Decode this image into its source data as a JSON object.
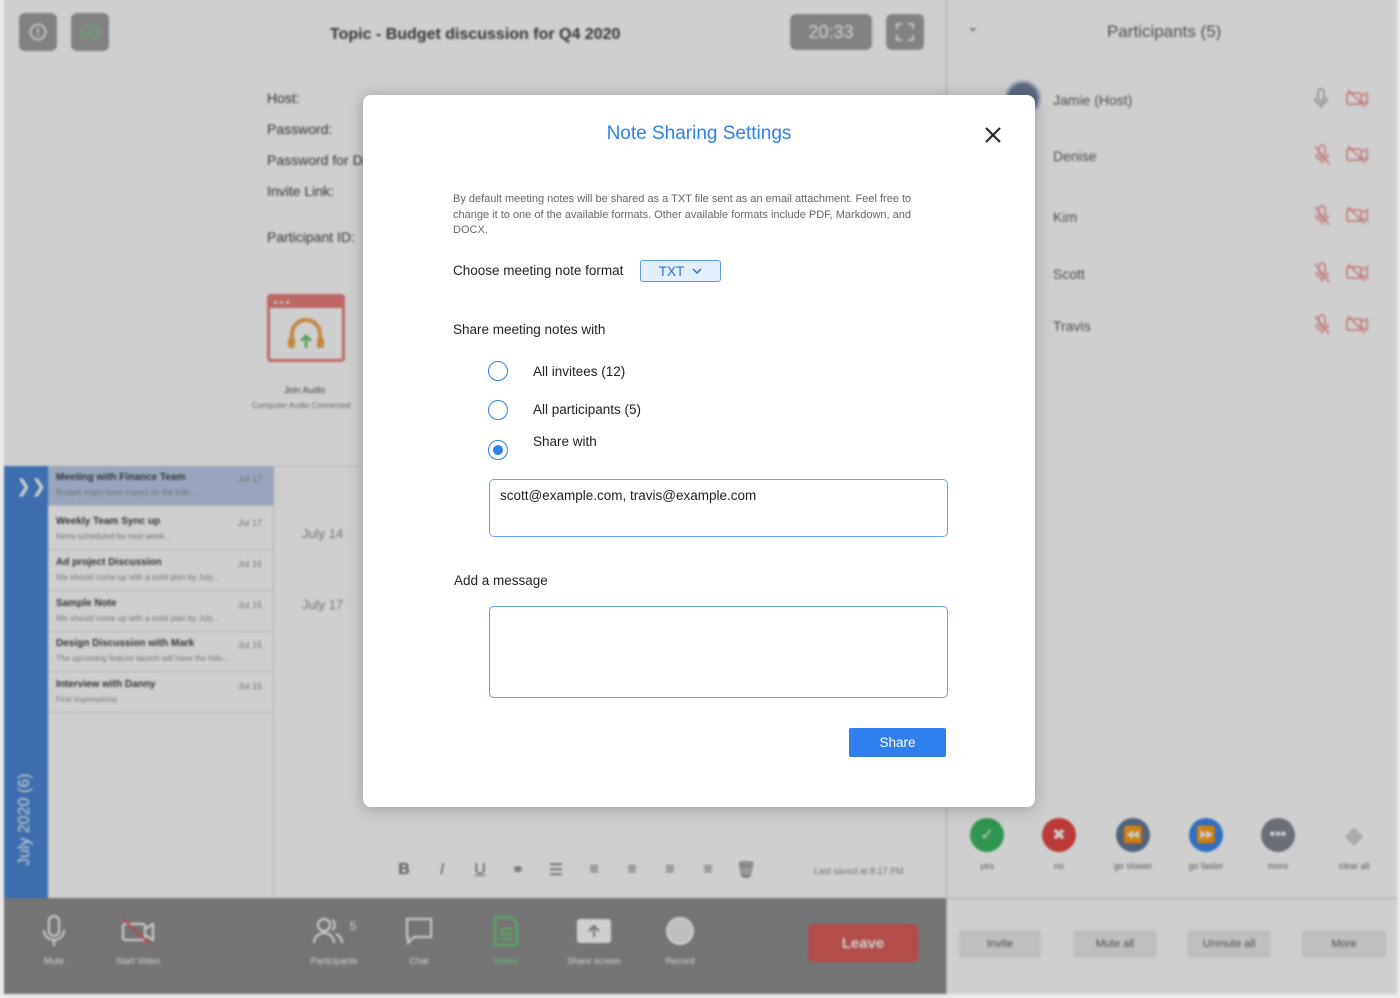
{
  "topbar": {
    "topic": "Topic - Budget discussion for Q4 2020",
    "timer": "20:33"
  },
  "meeting_info": {
    "host_label": "Host:",
    "password_label": "Password:",
    "password_di_label": "Password for Di",
    "invite_label": "Invite Link:",
    "participant_id_label": "Participant ID:"
  },
  "audio": {
    "join_label": "Join Audio",
    "status": "Computer Audio Connected"
  },
  "notes": {
    "month_label": "July 2020 (6)",
    "items": [
      {
        "title": "Meeting with Finance Team",
        "date": "Jul 17",
        "preview": "Budget might have impact on the follo..."
      },
      {
        "title": "Weekly Team Sync up",
        "date": "Jul 17",
        "preview": "Items scheduled for next week..."
      },
      {
        "title": "Ad project Discussion",
        "date": "Jul 16",
        "preview": "We should come up with a solid plan by July..."
      },
      {
        "title": "Sample Note",
        "date": "Jul 15",
        "preview": "We should come up with a solid plan by July..."
      },
      {
        "title": "Design Discussion with Mark",
        "date": "Jul 15",
        "preview": "The upcoming feature launch will have the follo..."
      },
      {
        "title": "Interview with Danny",
        "date": "Jul 15",
        "preview": "First impressions:"
      }
    ],
    "date_heads": [
      "July 14",
      "July 17"
    ],
    "last_saved": "Last saved at 8:17 PM"
  },
  "toolbar": {
    "mute": "Mute",
    "start_video": "Start Video",
    "participants": "Participants",
    "participants_count": "5",
    "chat": "Chat",
    "notes": "Notes",
    "share_screen": "Share screen",
    "record": "Record",
    "leave": "Leave"
  },
  "participants": {
    "title": "Participants (5)",
    "list": [
      {
        "name": "Jamie (Host)"
      },
      {
        "name": "Denise"
      },
      {
        "name": "Kim"
      },
      {
        "name": "Scott"
      },
      {
        "name": "Travis"
      }
    ],
    "reactions": [
      {
        "label": "yes",
        "color": "#2fb45a"
      },
      {
        "label": "no",
        "color": "#e53935"
      },
      {
        "label": "go slower",
        "color": "#5a6f8f"
      },
      {
        "label": "go faster",
        "color": "#2f80ed"
      },
      {
        "label": "more",
        "color": "#7a7f8a"
      },
      {
        "label": "clear all",
        "color": "#cfcfcf"
      }
    ],
    "buttons": {
      "invite": "Invite",
      "mute_all": "Mute all",
      "unmute_all": "Unmute all",
      "more": "More"
    }
  },
  "modal": {
    "title": "Note Sharing Settings",
    "description": "By default meeting notes will be shared as a TXT file sent as an email attachment. Feel free to change it to one of the available formats. Other available formats include PDF, Markdown, and DOCX.",
    "format_label": "Choose meeting note format",
    "format_value": "TXT",
    "share_label": "Share meeting notes with",
    "options": {
      "all_invitees": "All invitees (12)",
      "all_participants": "All participants (5)",
      "share_with": "Share with"
    },
    "share_with_value": "scott@example.com, travis@example.com",
    "message_label": "Add a message",
    "message_value": "",
    "share_button": "Share"
  },
  "colors": {
    "accent": "#2f80ed",
    "leave": "#d9534f",
    "month_strip": "#3d7fd6"
  }
}
